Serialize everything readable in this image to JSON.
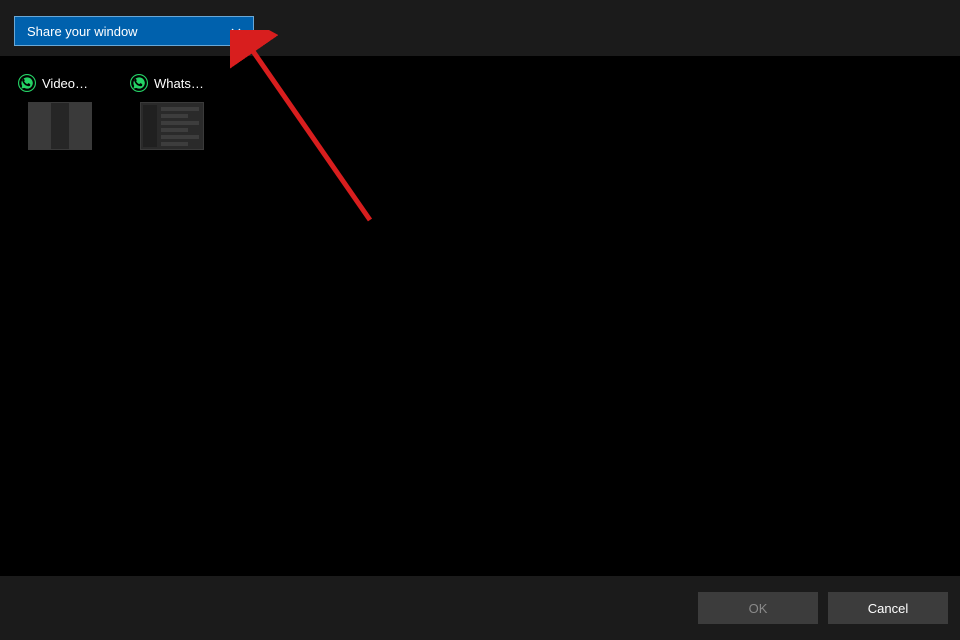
{
  "dropdown": {
    "label": "Share your window"
  },
  "windows": [
    {
      "label": "Video…"
    },
    {
      "label": "Whats…"
    }
  ],
  "buttons": {
    "ok": "OK",
    "cancel": "Cancel"
  },
  "colors": {
    "accent": "#0061ad",
    "annotation": "#d81e1e"
  }
}
